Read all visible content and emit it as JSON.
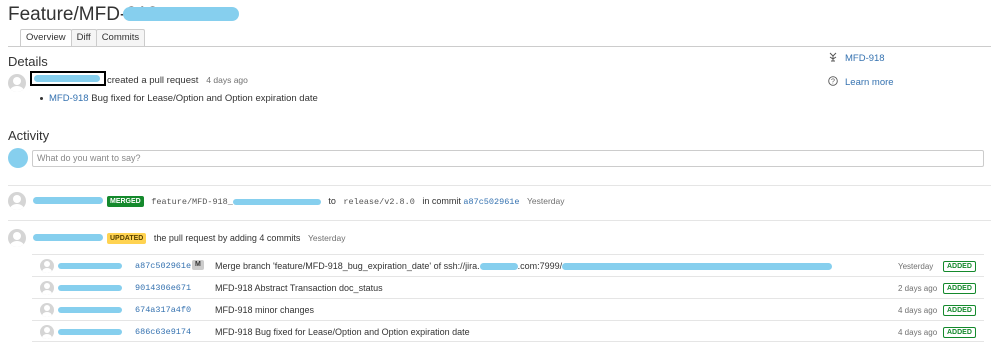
{
  "header": {
    "title": "Feature/MFD-918"
  },
  "tabs": [
    {
      "label": "Overview",
      "active": true
    },
    {
      "label": "Diff",
      "active": false
    },
    {
      "label": "Commits",
      "active": false
    }
  ],
  "details": {
    "heading": "Details",
    "action_text": "created a pull request",
    "time": "4 days ago",
    "issue_link": "MFD-918",
    "issue_text": "Bug fixed for Lease/Option and Option expiration date"
  },
  "sidebar": {
    "jira_link": "MFD-918",
    "learn_more": "Learn more"
  },
  "activity": {
    "heading": "Activity",
    "comment_placeholder": "What do you want to say?",
    "merged_event": {
      "badge": "MERGED",
      "source_branch": "feature/MFD-918_",
      "to_text": "to",
      "target_branch": "release/v2.8.0",
      "in_commit_text": "in commit",
      "commit_hash": "a87c502961e",
      "time": "Yesterday"
    },
    "updated_event": {
      "badge": "UPDATED",
      "text": "the pull request by adding 4 commits",
      "time": "Yesterday"
    }
  },
  "commits": [
    {
      "hash": "a87c502961e",
      "merge_badge": "M",
      "message": "Merge branch 'feature/MFD-918_bug_expiration_date' of ssh://jira.",
      "message_tail": ".com:7999/",
      "time": "Yesterday",
      "status": "ADDED"
    },
    {
      "hash": "9014306e671",
      "merge_badge": "",
      "message": "MFD-918 Abstract Transaction doc_status",
      "message_tail": "",
      "time": "2 days ago",
      "status": "ADDED"
    },
    {
      "hash": "674a317a4f0",
      "merge_badge": "",
      "message": "MFD-918 minor changes",
      "message_tail": "",
      "time": "4 days ago",
      "status": "ADDED"
    },
    {
      "hash": "686c63e9174",
      "merge_badge": "",
      "message": "MFD-918 Bug fixed for Lease/Option and Option expiration date",
      "message_tail": "",
      "time": "4 days ago",
      "status": "ADDED"
    }
  ],
  "colors": {
    "link": "#3572b0",
    "merged": "#14892c",
    "updated": "#ffd351",
    "redaction": "#86cfee"
  }
}
